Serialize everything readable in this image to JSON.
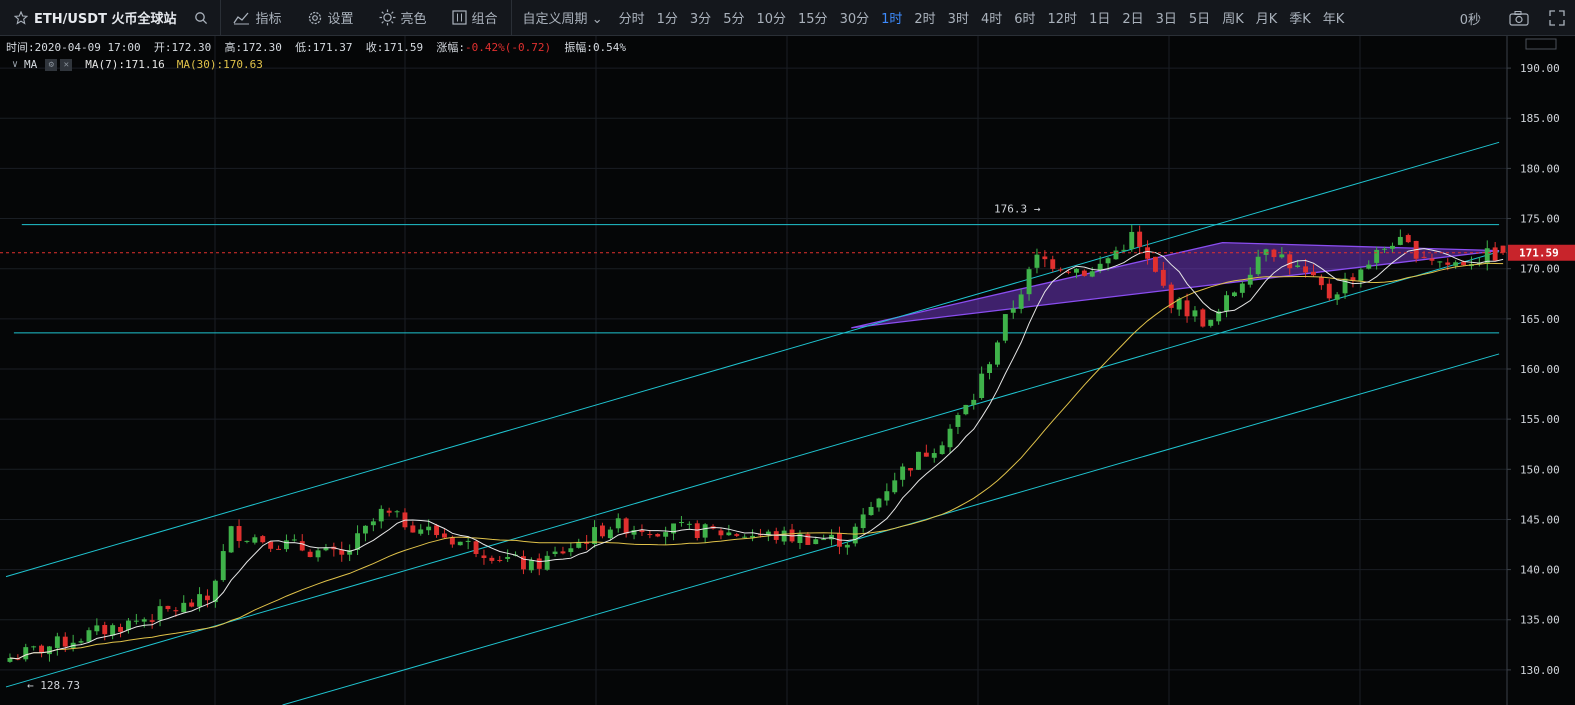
{
  "toolbar": {
    "symbol": "ETH/USDT 火币全球站",
    "tools": {
      "indicators": "指标",
      "settings": "设置",
      "theme": "亮色",
      "combo": "组合"
    },
    "custom_period": "自定义周期",
    "periods": [
      "分时",
      "1分",
      "3分",
      "5分",
      "10分",
      "15分",
      "30分",
      "1时",
      "2时",
      "3时",
      "4时",
      "6时",
      "12时",
      "1日",
      "2日",
      "3日",
      "5日",
      "周K",
      "月K",
      "季K",
      "年K"
    ],
    "active_period": "1时",
    "seconds": "0秒"
  },
  "info": {
    "time_label": "时间:",
    "time": "2020-04-09 17:00",
    "open_label": "开:",
    "open": "172.30",
    "high_label": "高:",
    "high": "172.30",
    "low_label": "低:",
    "low": "171.37",
    "close_label": "收:",
    "close": "171.59",
    "change_label": "涨幅:",
    "change": "-0.42%(-0.72)",
    "amp_label": "振幅:",
    "amplitude": "0.54%"
  },
  "ma": {
    "label": "MA",
    "ma7": "MA(7):171.16",
    "ma30": "MA(30):170.63"
  },
  "colors": {
    "up": "#3fb24a",
    "down": "#e0302f",
    "ma7": "#e6e6e6",
    "ma30": "#e0c24a",
    "trend": "#1fc4d0",
    "triangle": "#7a3cd1",
    "active": "#3d8bfd"
  },
  "chart_data": {
    "type": "candlestick",
    "price_axis": {
      "ticks": [
        "130.00",
        "135.00",
        "140.00",
        "145.00",
        "150.00",
        "155.00",
        "160.00",
        "165.00",
        "170.00",
        "175.00",
        "180.00",
        "185.00",
        "190.00"
      ],
      "range": [
        126.5,
        193.2
      ]
    },
    "current_price": "171.59",
    "annotations": {
      "high_label": "176.3 →",
      "low_label": "← 128.73"
    },
    "trendlines": [
      {
        "from": [
          0,
          139.3
        ],
        "to": [
          189,
          182.6
        ]
      },
      {
        "from": [
          0,
          128.3
        ],
        "to": [
          189,
          171.7
        ]
      },
      {
        "from": [
          35,
          126.5
        ],
        "to": [
          189,
          161.5
        ]
      },
      {
        "from": [
          2,
          174.4
        ],
        "to": [
          189,
          174.4
        ]
      },
      {
        "from": [
          1,
          163.6
        ],
        "to": [
          189,
          163.6
        ]
      }
    ],
    "triangle": [
      [
        107,
        164.1
      ],
      [
        154,
        172.6
      ],
      [
        189,
        171.8
      ]
    ],
    "segments": [
      {
        "from": 0,
        "to": 25,
        "start": 131.2,
        "end": 137.0
      },
      {
        "from": 25,
        "to": 28,
        "start": 137.0,
        "end": 143.8
      },
      {
        "from": 28,
        "to": 42,
        "start": 143.8,
        "end": 141.2
      },
      {
        "from": 42,
        "to": 47,
        "start": 141.2,
        "end": 145.6
      },
      {
        "from": 47,
        "to": 66,
        "start": 145.6,
        "end": 140.2
      },
      {
        "from": 66,
        "to": 76,
        "start": 140.2,
        "end": 144.4
      },
      {
        "from": 76,
        "to": 106,
        "start": 144.4,
        "end": 142.9
      },
      {
        "from": 106,
        "to": 112,
        "start": 142.9,
        "end": 149.3
      },
      {
        "from": 112,
        "to": 118,
        "start": 149.3,
        "end": 153.0
      },
      {
        "from": 118,
        "to": 122,
        "start": 153.0,
        "end": 157.2
      },
      {
        "from": 122,
        "to": 126,
        "start": 157.2,
        "end": 164.8
      },
      {
        "from": 126,
        "to": 130,
        "start": 164.8,
        "end": 171.0
      },
      {
        "from": 130,
        "to": 137,
        "start": 171.0,
        "end": 169.6
      },
      {
        "from": 137,
        "to": 142,
        "start": 169.6,
        "end": 173.2
      },
      {
        "from": 142,
        "to": 147,
        "start": 173.2,
        "end": 166.8
      },
      {
        "from": 147,
        "to": 152,
        "start": 166.8,
        "end": 164.4
      },
      {
        "from": 152,
        "to": 159,
        "start": 164.4,
        "end": 172.5
      },
      {
        "from": 159,
        "to": 167,
        "start": 172.5,
        "end": 167.3
      },
      {
        "from": 167,
        "to": 175,
        "start": 167.3,
        "end": 172.8
      },
      {
        "from": 175,
        "to": 182,
        "start": 172.8,
        "end": 170.4
      },
      {
        "from": 182,
        "to": 189,
        "start": 170.4,
        "end": 171.6
      }
    ],
    "count": 190
  }
}
